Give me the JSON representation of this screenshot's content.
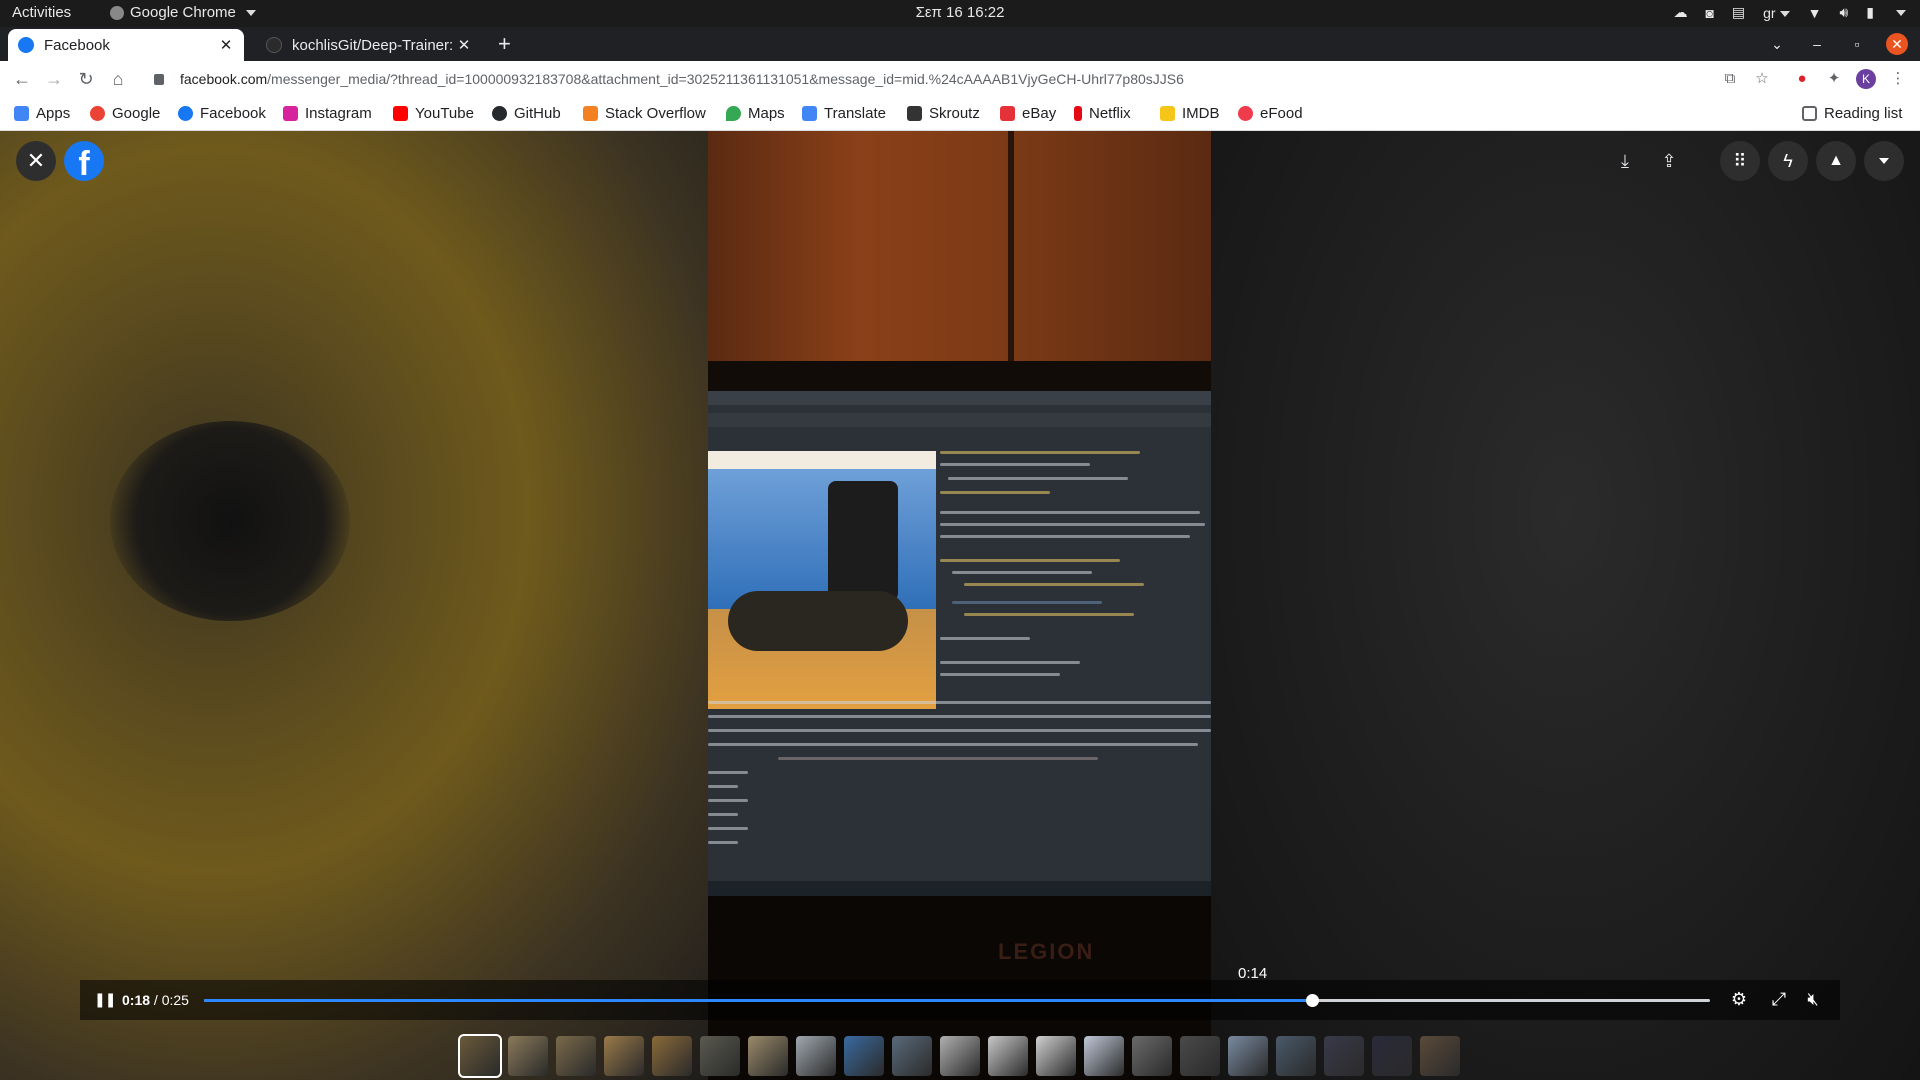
{
  "topbar": {
    "activities": "Activities",
    "app_name": "Google Chrome",
    "clock": "Σεπ 16  16:22",
    "keyboard_layout": "gr"
  },
  "tabs": [
    {
      "title": "Facebook",
      "favicon_color": "#1877f2",
      "active": true
    },
    {
      "title": "kochlisGit/Deep-Trainer: ",
      "favicon_color": "#2b2b2b",
      "active": false
    }
  ],
  "address_bar": {
    "host": "facebook.com",
    "path": "/messenger_media/?thread_id=100000932183708&attachment_id=3025211361131051&message_id=mid.%24cAAAAB1VjyGeCH-Uhrl77p80sJJS6"
  },
  "profile_initial": "K",
  "bookmarks": [
    {
      "label": "Apps",
      "icon": "apps-grid-icon",
      "color": "#4285f4"
    },
    {
      "label": "Google",
      "icon": "google-icon",
      "color": "#ea4335"
    },
    {
      "label": "Facebook",
      "icon": "facebook-icon",
      "color": "#1877f2"
    },
    {
      "label": "Instagram",
      "icon": "instagram-icon",
      "color": "#d6249f"
    },
    {
      "label": "YouTube",
      "icon": "youtube-icon",
      "color": "#ff0000"
    },
    {
      "label": "GitHub",
      "icon": "github-icon",
      "color": "#24292e"
    },
    {
      "label": "Stack Overflow",
      "icon": "stackoverflow-icon",
      "color": "#f48024"
    },
    {
      "label": "Maps",
      "icon": "maps-icon",
      "color": "#34a853"
    },
    {
      "label": "Translate",
      "icon": "translate-icon",
      "color": "#4285f4"
    },
    {
      "label": "Skroutz",
      "icon": "skroutz-icon",
      "color": "#333333"
    },
    {
      "label": "eBay",
      "icon": "ebay-icon",
      "color": "#e53238"
    },
    {
      "label": "Netflix",
      "icon": "netflix-icon",
      "color": "#e50914"
    },
    {
      "label": "IMDB",
      "icon": "imdb-icon",
      "color": "#f5c518"
    },
    {
      "label": "eFood",
      "icon": "efood-icon",
      "color": "#ef3b4b"
    }
  ],
  "reading_list": "Reading list",
  "video": {
    "current_time": "0:18",
    "duration": "0:25",
    "progress_fraction": 0.736,
    "hover_time": "0:14",
    "brand_text": "LEGION"
  },
  "thumbnails": [
    "#6a5a3a",
    "#8a7a5a",
    "#7a6a4a",
    "#9a7a4a",
    "#8a6a3a",
    "#5a5a50",
    "#9a8a6a",
    "#a0a8b0",
    "#3a6aa0",
    "#5a6a7a",
    "#b0b0b0",
    "#c8c8c8",
    "#d0d0d0",
    "#c0c8d8",
    "#6a6a6a",
    "#4a4a4a",
    "#7a8aa0",
    "#4a5a6a",
    "#3a3a4a",
    "#2a2a3a",
    "#5a4a3a"
  ],
  "colors": {
    "accent": "#2d88ff",
    "facebook_blue": "#1877f2"
  }
}
